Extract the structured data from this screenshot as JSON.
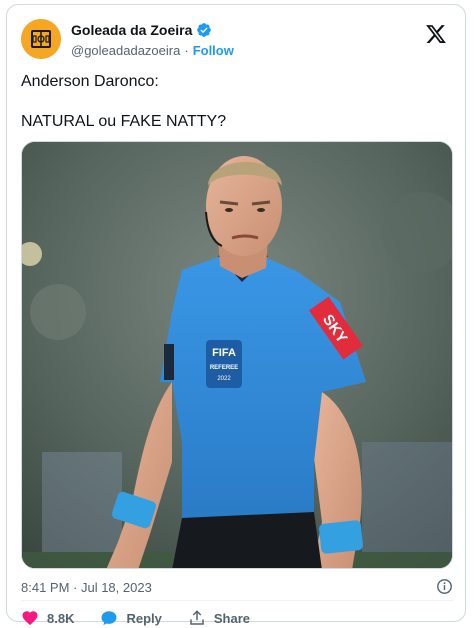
{
  "tweet": {
    "author_name": "Goleada da Zoeira",
    "handle": "@goleadadazoeira",
    "separator": "·",
    "follow_label": "Follow",
    "text_line1": "Anderson Daronco:",
    "text_line2": "NATURAL ou FAKE NATTY?",
    "timestamp": "8:41 PM · Jul 18, 2023"
  },
  "image": {
    "badge_title": "FIFA",
    "badge_subtitle": "REFEREE",
    "badge_year": "2022",
    "sleeve_logo": "SKY"
  },
  "actions": {
    "like_count": "8.8K",
    "reply_label": "Reply",
    "share_label": "Share"
  },
  "icons": {
    "verified": "verified-badge-icon",
    "x_logo": "x-logo-icon",
    "info": "info-icon",
    "heart": "heart-icon",
    "reply": "reply-bubble-icon",
    "share": "share-icon"
  },
  "colors": {
    "accent": "#1d9bf0",
    "like": "#f91880",
    "muted": "#536471",
    "avatar_bg": "#f5a623",
    "jersey": "#2f8ad8"
  }
}
